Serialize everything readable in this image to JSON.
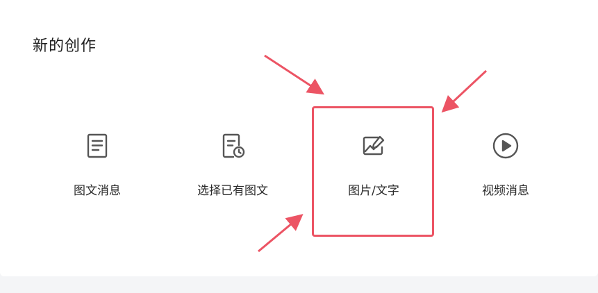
{
  "section": {
    "title": "新的创作"
  },
  "options": [
    {
      "label": "图文消息",
      "icon": "document-icon"
    },
    {
      "label": "选择已有图文",
      "icon": "document-clock-icon"
    },
    {
      "label": "图片/文字",
      "icon": "image-edit-icon"
    },
    {
      "label": "视频消息",
      "icon": "play-circle-icon"
    }
  ],
  "colors": {
    "highlight": "#ec5464",
    "icon": "#555555",
    "background": "#f4f5f7"
  }
}
